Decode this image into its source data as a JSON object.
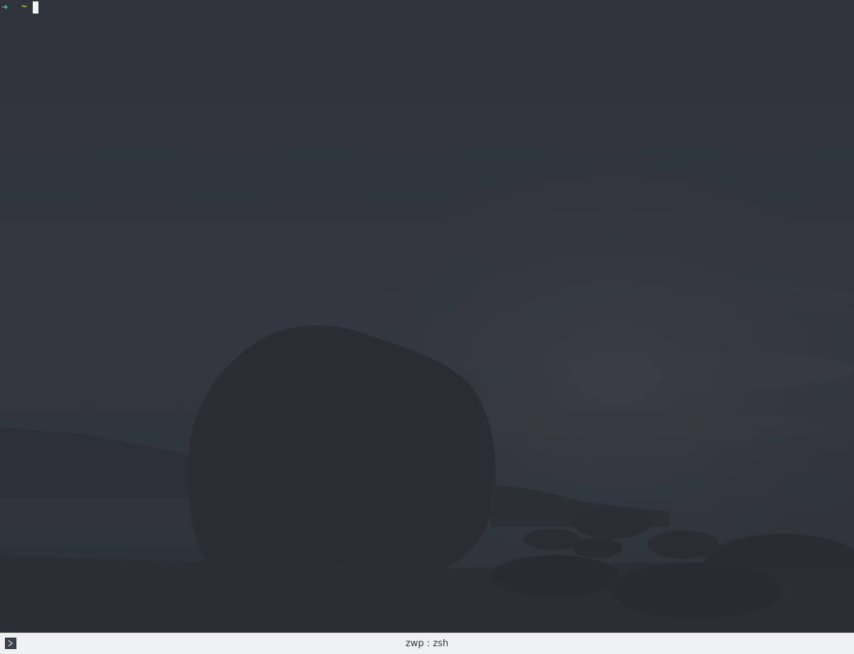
{
  "terminal": {
    "prompt_arrow": "➜",
    "prompt_cwd": "~"
  },
  "statusbar": {
    "icon": "terminal-app-icon",
    "title": "zwp : zsh"
  },
  "colors": {
    "background": "#2f343c",
    "prompt_arrow": "#35c6a4",
    "prompt_cwd": "#c9c13a",
    "cursor": "#f2f4f5",
    "statusbar": "#eff0f1"
  }
}
